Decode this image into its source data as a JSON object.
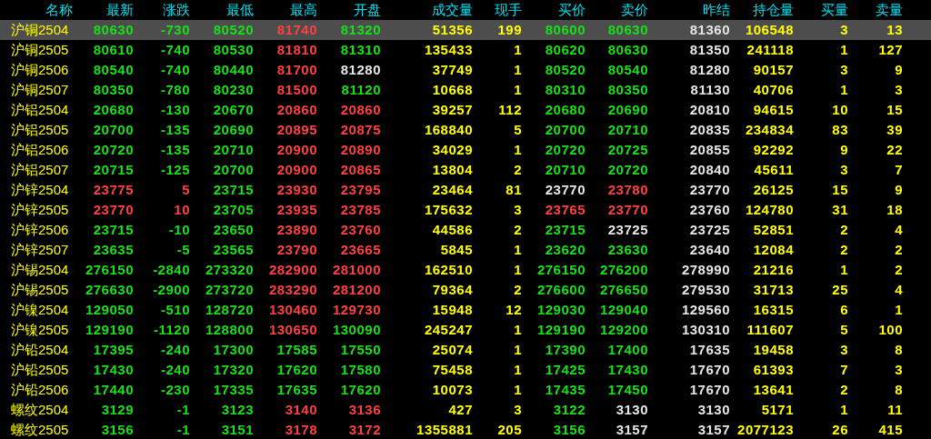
{
  "columns": [
    {
      "label": "名称",
      "kind": "name"
    },
    {
      "label": "最新",
      "kind": "price"
    },
    {
      "label": "涨跌",
      "kind": "change"
    },
    {
      "label": "最低",
      "kind": "price"
    },
    {
      "label": "最高",
      "kind": "price"
    },
    {
      "label": "开盘",
      "kind": "price"
    },
    {
      "label": "成交量",
      "kind": "volume"
    },
    {
      "label": "现手",
      "kind": "volume"
    },
    {
      "label": "买价",
      "kind": "price"
    },
    {
      "label": "卖价",
      "kind": "price"
    },
    {
      "label": "昨结",
      "kind": "settle"
    },
    {
      "label": "持仓量",
      "kind": "volume"
    },
    {
      "label": "买量",
      "kind": "volume"
    },
    {
      "label": "卖量",
      "kind": "volume"
    }
  ],
  "rows": [
    {
      "selected": true,
      "cells": [
        "沪铜2504",
        "80630",
        "-730",
        "80520",
        "81740",
        "81320",
        "51356",
        "199",
        "80600",
        "80630",
        "81360",
        "106548",
        "3",
        "13"
      ]
    },
    {
      "selected": false,
      "cells": [
        "沪铜2505",
        "80610",
        "-740",
        "80530",
        "81810",
        "81310",
        "135433",
        "1",
        "80620",
        "80630",
        "81350",
        "241118",
        "1",
        "127"
      ]
    },
    {
      "selected": false,
      "cells": [
        "沪铜2506",
        "80540",
        "-740",
        "80440",
        "81700",
        "81280",
        "37749",
        "1",
        "80520",
        "80540",
        "81280",
        "90157",
        "3",
        "9"
      ]
    },
    {
      "selected": false,
      "cells": [
        "沪铜2507",
        "80350",
        "-780",
        "80230",
        "81500",
        "81120",
        "10668",
        "1",
        "80310",
        "80350",
        "81130",
        "40706",
        "1",
        "3"
      ]
    },
    {
      "selected": false,
      "cells": [
        "沪铝2504",
        "20680",
        "-130",
        "20670",
        "20860",
        "20860",
        "39257",
        "112",
        "20680",
        "20690",
        "20810",
        "94615",
        "10",
        "15"
      ]
    },
    {
      "selected": false,
      "cells": [
        "沪铝2505",
        "20700",
        "-135",
        "20690",
        "20895",
        "20875",
        "168840",
        "5",
        "20700",
        "20710",
        "20835",
        "234834",
        "83",
        "39"
      ]
    },
    {
      "selected": false,
      "cells": [
        "沪铝2506",
        "20720",
        "-135",
        "20710",
        "20900",
        "20890",
        "34029",
        "1",
        "20720",
        "20725",
        "20855",
        "92292",
        "9",
        "22"
      ]
    },
    {
      "selected": false,
      "cells": [
        "沪铝2507",
        "20715",
        "-125",
        "20700",
        "20900",
        "20865",
        "13804",
        "2",
        "20710",
        "20720",
        "20840",
        "45611",
        "3",
        "7"
      ]
    },
    {
      "selected": false,
      "cells": [
        "沪锌2504",
        "23775",
        "5",
        "23715",
        "23930",
        "23795",
        "23464",
        "81",
        "23770",
        "23780",
        "23770",
        "26125",
        "15",
        "9"
      ]
    },
    {
      "selected": false,
      "cells": [
        "沪锌2505",
        "23770",
        "10",
        "23705",
        "23935",
        "23785",
        "175632",
        "3",
        "23765",
        "23770",
        "23760",
        "124780",
        "31",
        "18"
      ]
    },
    {
      "selected": false,
      "cells": [
        "沪锌2506",
        "23715",
        "-10",
        "23650",
        "23890",
        "23760",
        "44586",
        "2",
        "23715",
        "23725",
        "23725",
        "52851",
        "2",
        "4"
      ]
    },
    {
      "selected": false,
      "cells": [
        "沪锌2507",
        "23635",
        "-5",
        "23565",
        "23790",
        "23665",
        "5845",
        "1",
        "23620",
        "23630",
        "23640",
        "12084",
        "2",
        "2"
      ]
    },
    {
      "selected": false,
      "cells": [
        "沪锡2504",
        "276150",
        "-2840",
        "273320",
        "282900",
        "281000",
        "162510",
        "1",
        "276150",
        "276200",
        "278990",
        "21216",
        "1",
        "2"
      ]
    },
    {
      "selected": false,
      "cells": [
        "沪锡2505",
        "276630",
        "-2900",
        "273720",
        "283290",
        "281200",
        "79364",
        "2",
        "276600",
        "276650",
        "279530",
        "31713",
        "25",
        "4"
      ]
    },
    {
      "selected": false,
      "cells": [
        "沪镍2504",
        "129050",
        "-510",
        "128720",
        "130460",
        "129730",
        "15948",
        "12",
        "129030",
        "129040",
        "129560",
        "16315",
        "6",
        "1"
      ]
    },
    {
      "selected": false,
      "cells": [
        "沪镍2505",
        "129190",
        "-1120",
        "128800",
        "130650",
        "130090",
        "245247",
        "1",
        "129190",
        "129200",
        "130310",
        "111607",
        "5",
        "100"
      ]
    },
    {
      "selected": false,
      "cells": [
        "沪铅2504",
        "17395",
        "-240",
        "17300",
        "17585",
        "17550",
        "25074",
        "1",
        "17390",
        "17400",
        "17635",
        "19458",
        "3",
        "8"
      ]
    },
    {
      "selected": false,
      "cells": [
        "沪铅2505",
        "17430",
        "-240",
        "17320",
        "17620",
        "17580",
        "75458",
        "1",
        "17425",
        "17430",
        "17670",
        "61393",
        "7",
        "3"
      ]
    },
    {
      "selected": false,
      "cells": [
        "沪铅2506",
        "17440",
        "-230",
        "17335",
        "17635",
        "17620",
        "10073",
        "1",
        "17435",
        "17450",
        "17670",
        "13641",
        "2",
        "8"
      ]
    },
    {
      "selected": false,
      "cells": [
        "螺纹2504",
        "3129",
        "-1",
        "3123",
        "3140",
        "3136",
        "427",
        "3",
        "3122",
        "3130",
        "3130",
        "5171",
        "1",
        "11"
      ]
    },
    {
      "selected": false,
      "cells": [
        "螺纹2505",
        "3156",
        "-1",
        "3151",
        "3178",
        "3172",
        "1355881",
        "205",
        "3156",
        "3157",
        "3157",
        "2077123",
        "26",
        "415"
      ]
    }
  ]
}
